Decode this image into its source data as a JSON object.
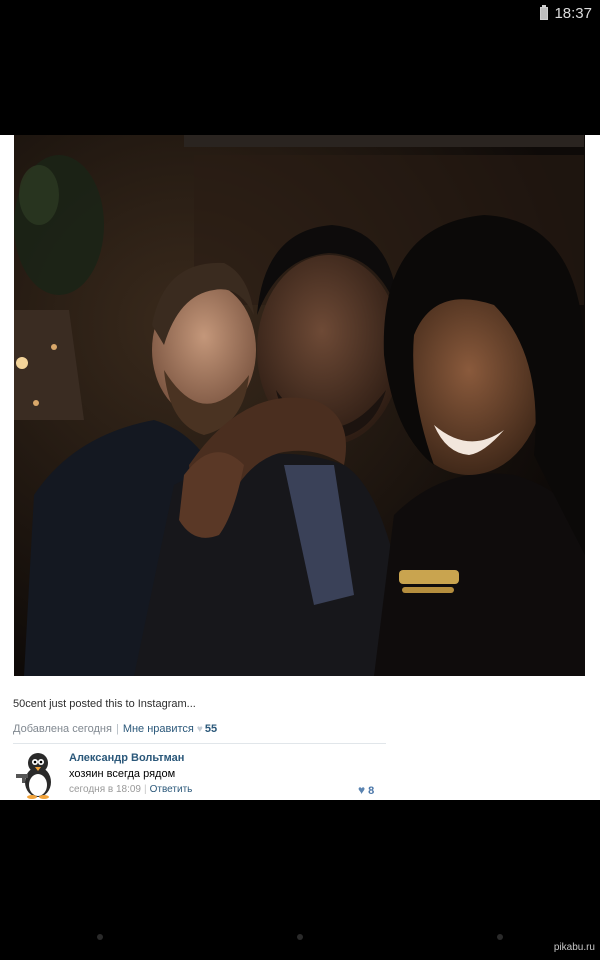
{
  "status_bar": {
    "time": "18:37",
    "icons": [
      "battery-icon"
    ]
  },
  "post": {
    "caption": "50cent just posted this to Instagram...",
    "added_label": "Добавлена сегодня",
    "like_label": "Мне нравится",
    "like_count": "55"
  },
  "comment": {
    "author": "Александр Вольтман",
    "text": "хозяин всегда рядом",
    "timestamp": "сегодня в 18:09",
    "reply_label": "Ответить",
    "likes": "8"
  },
  "watermark": "pikabu.ru",
  "colors": {
    "link": "#2b587a",
    "muted": "#808890",
    "background": "#000000",
    "card": "#ffffff"
  }
}
